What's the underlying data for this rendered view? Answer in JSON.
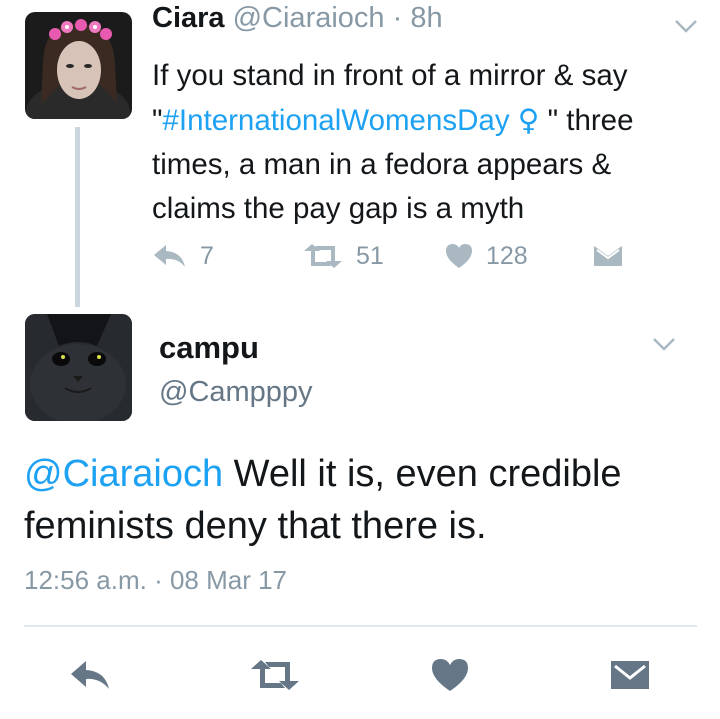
{
  "colors": {
    "link": "#1da1f2",
    "muted": "#8899a6",
    "icon": "#657786",
    "divider": "#e1e8ed",
    "thread_line": "#ccd6dd"
  },
  "tweet1": {
    "name": "Ciara",
    "handle": "@Ciaraioch",
    "separator": " · ",
    "time": "8h",
    "text_before": "If you stand in front of a mirror & say \"",
    "hashtag": "#InternationalWomensDay",
    "emoji": "♀",
    "text_after": " \" three times, a man in a fedora appears & claims the pay gap is a myth",
    "replies": "7",
    "retweets": "51",
    "likes": "128"
  },
  "tweet2": {
    "name": "campu",
    "handle": "@Campppy",
    "mention": "@Ciaraioch",
    "text": " Well it is, even credible feminists deny that there is.",
    "timestamp": "12:56 a.m. · 08 Mar 17"
  },
  "icons": {
    "reply": "reply-icon",
    "retweet": "retweet-icon",
    "like": "heart-icon",
    "dm": "envelope-icon",
    "menu": "chevron-down-icon"
  }
}
